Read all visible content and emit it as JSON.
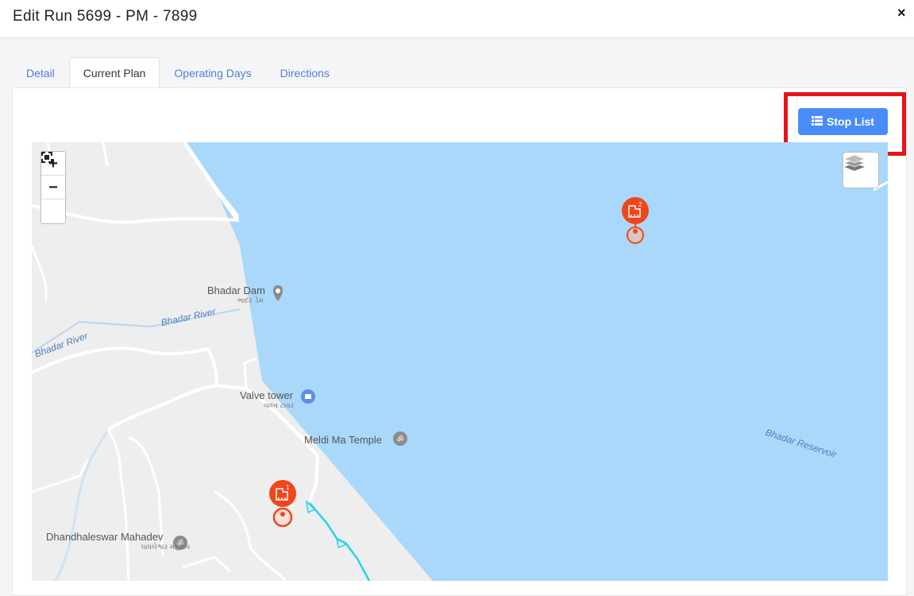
{
  "modal": {
    "title": "Edit Run 5699 - PM - 7899",
    "close_label": "×"
  },
  "tabs": [
    {
      "label": "Detail",
      "active": false
    },
    {
      "label": "Current Plan",
      "active": true
    },
    {
      "label": "Operating Days",
      "active": false
    },
    {
      "label": "Directions",
      "active": false
    }
  ],
  "toolbar": {
    "stop_list_label": "Stop List",
    "stop_list_icon": "list-icon"
  },
  "map": {
    "zoom_in": "+",
    "zoom_out": "−",
    "fullscreen_icon": "fullscreen-icon",
    "layers_icon": "layers-icon",
    "places": [
      {
        "name": "Bhadar Dam",
        "local": "ભાદર ડેમ",
        "icon": "pin-icon"
      },
      {
        "name": "Valve tower",
        "local": "વાલ્વ ટાવર",
        "icon": "shop-icon"
      },
      {
        "name": "Meldi Ma Temple",
        "icon": "om-icon"
      },
      {
        "name": "Dhandhaleswar Mahadev",
        "local": "ધાંધલેશ્વર મહાદેવ",
        "icon": "om-icon"
      }
    ],
    "water_labels": [
      "Bhadar River",
      "Bhadar River",
      "Bhadar Reservoir"
    ],
    "stops": [
      {
        "number": "1",
        "icon": "factory-icon"
      },
      {
        "number": "2",
        "icon": "factory-icon"
      }
    ],
    "colors": {
      "water": "#a9d8fb",
      "land": "#eeeeee",
      "route": "#22d3f0",
      "stop_marker": "#f0461c"
    }
  }
}
